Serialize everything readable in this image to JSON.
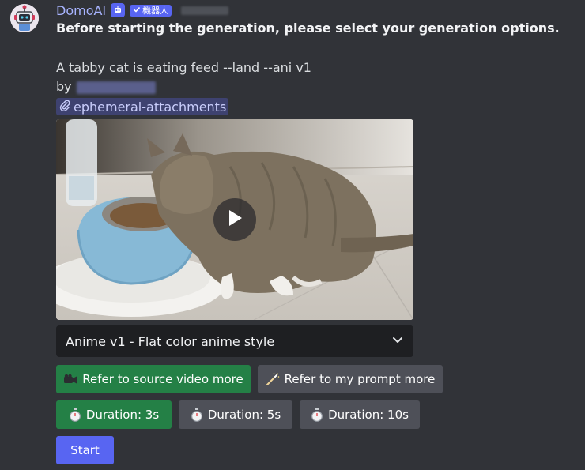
{
  "message": {
    "author": "DomoAI",
    "bot_tag": "機器人",
    "heading": "Before starting the generation, please select your generation options.",
    "prompt": "A tabby cat is eating feed --land --ani v1",
    "by_label": "by",
    "attachment_mention": "ephemeral-attachments"
  },
  "video": {
    "play_icon": "play-icon"
  },
  "style_select": {
    "selected": "Anime v1 - Flat color anime style"
  },
  "buttons": {
    "refer_source": "Refer to source video more",
    "refer_prompt": "Refer to my prompt more",
    "duration_3": "Duration: 3s",
    "duration_5": "Duration: 5s",
    "duration_10": "Duration: 10s",
    "start": "Start"
  },
  "colors": {
    "background": "#313338",
    "username": "#a8b4ff",
    "selected_green": "#248046",
    "secondary_grey": "#4e5058",
    "primary_blurple": "#5865f2"
  }
}
